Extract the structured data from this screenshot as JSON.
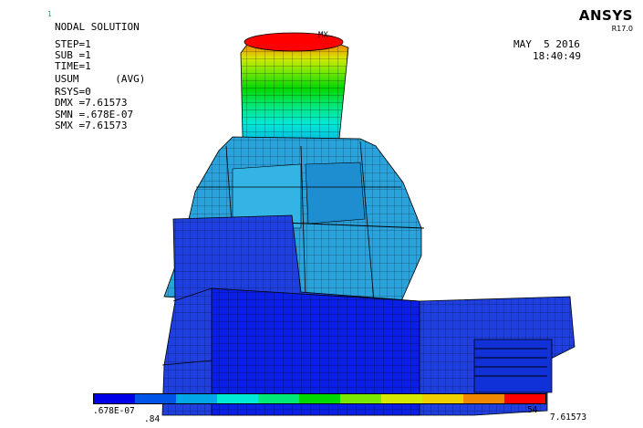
{
  "corner_mark": "1",
  "title": "NODAL SOLUTION",
  "params": [
    "STEP=1",
    "SUB =1",
    "TIME=1",
    "USUM      (AVG)",
    "RSYS=0",
    "DMX =7.61573",
    "SMN =.678E-07",
    "SMX =7.61573"
  ],
  "date": "MAY  5 2016",
  "time": "18:40:49",
  "logo": {
    "brand": "ANSYS",
    "version": "R17.0"
  },
  "max_marker": "MX",
  "legend": {
    "colors": [
      "#0000e8",
      "#0055e8",
      "#00a6e8",
      "#00e8d6",
      "#00e878",
      "#00d800",
      "#7ae800",
      "#d4e800",
      "#f0d000",
      "#f08800",
      "#ff0000"
    ],
    "labels_bottom": [
      ".678E-07",
      "7.61573"
    ],
    "labels_partial": [
      ".84",
      "54"
    ]
  },
  "colors": {
    "accent_max": "#ff0000",
    "accent_min": "#0000e8"
  }
}
